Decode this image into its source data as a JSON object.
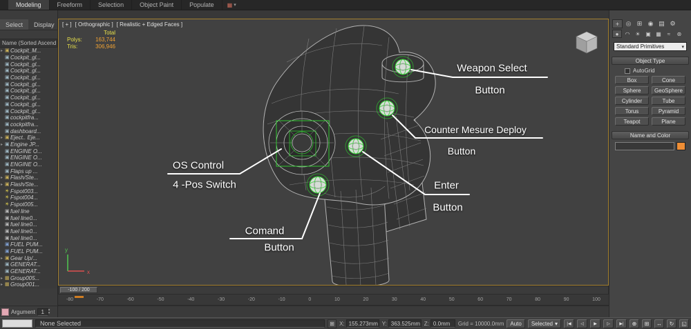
{
  "ribbon": {
    "tabs": [
      "Modeling",
      "Freeform",
      "Selection",
      "Object Paint",
      "Populate"
    ],
    "tool_icon": "▦",
    "dropdown_arrow": "▾"
  },
  "explorer": {
    "tab_select": "Select",
    "tab_display": "Display",
    "header": "Name (Sorted Ascend...",
    "items": [
      {
        "a": "▸",
        "g": "▣",
        "c": "#c9b05a",
        "t": "Cockpit_M..."
      },
      {
        "a": "",
        "g": "▣",
        "c": "#9db6c2",
        "t": "Cockpit_gl..."
      },
      {
        "a": "",
        "g": "▣",
        "c": "#9db6c2",
        "t": "Cockpit_gl..."
      },
      {
        "a": "",
        "g": "▣",
        "c": "#9db6c2",
        "t": "Cockpit_gl..."
      },
      {
        "a": "",
        "g": "▣",
        "c": "#9db6c2",
        "t": "Cockpit_gl..."
      },
      {
        "a": "",
        "g": "▣",
        "c": "#9db6c2",
        "t": "Cockpit_gl..."
      },
      {
        "a": "",
        "g": "▣",
        "c": "#9db6c2",
        "t": "Cockpit_gl..."
      },
      {
        "a": "",
        "g": "▣",
        "c": "#9db6c2",
        "t": "Cockpit_gl..."
      },
      {
        "a": "",
        "g": "▣",
        "c": "#9db6c2",
        "t": "Cockpit_gl..."
      },
      {
        "a": "",
        "g": "▣",
        "c": "#9db6c2",
        "t": "Cockpit_gl..."
      },
      {
        "a": "",
        "g": "▣",
        "c": "#9db6c2",
        "t": "cockpitfra..."
      },
      {
        "a": "",
        "g": "▣",
        "c": "#9db6c2",
        "t": "cockpitfra..."
      },
      {
        "a": "",
        "g": "▣",
        "c": "#9db6c2",
        "t": "dashboard..."
      },
      {
        "a": "▸",
        "g": "▣",
        "c": "#c9b05a",
        "t": "Eject.. Eje..."
      },
      {
        "a": "▸",
        "g": "▣",
        "c": "#9db6c2",
        "t": "Engine JP..."
      },
      {
        "a": "",
        "g": "▣",
        "c": "#9db6c2",
        "t": "ENGINE O..."
      },
      {
        "a": "",
        "g": "▣",
        "c": "#9db6c2",
        "t": "ENGINE O..."
      },
      {
        "a": "",
        "g": "▣",
        "c": "#9db6c2",
        "t": "ENGINE O..."
      },
      {
        "a": "",
        "g": "▣",
        "c": "#9db6c2",
        "t": "Flaps up ..."
      },
      {
        "a": "▸",
        "g": "▣",
        "c": "#c9b05a",
        "t": "Flash/Ste..."
      },
      {
        "a": "▸",
        "g": "▣",
        "c": "#c9b05a",
        "t": "Flash/Ste..."
      },
      {
        "a": "",
        "g": "☀",
        "c": "#e6d44e",
        "t": "Fspot003..."
      },
      {
        "a": "",
        "g": "☀",
        "c": "#e6d44e",
        "t": "Fspot004..."
      },
      {
        "a": "",
        "g": "☀",
        "c": "#e6d44e",
        "t": "Fspot005..."
      },
      {
        "a": "",
        "g": "▣",
        "c": "#b8b8b8",
        "t": "fuel line"
      },
      {
        "a": "",
        "g": "▣",
        "c": "#b8b8b8",
        "t": "fuel line0..."
      },
      {
        "a": "",
        "g": "▣",
        "c": "#b8b8b8",
        "t": "fuel line0..."
      },
      {
        "a": "",
        "g": "▣",
        "c": "#b8b8b8",
        "t": "fuel line0..."
      },
      {
        "a": "",
        "g": "▣",
        "c": "#b8b8b8",
        "t": "fuel line0..."
      },
      {
        "a": "",
        "g": "▣",
        "c": "#7f9fd0",
        "t": "FUEL PUM..."
      },
      {
        "a": "",
        "g": "▣",
        "c": "#7f9fd0",
        "t": "FUEL PUM..."
      },
      {
        "a": "▸",
        "g": "▣",
        "c": "#c9b05a",
        "t": "Gear Up/..."
      },
      {
        "a": "",
        "g": "▣",
        "c": "#9db6c2",
        "t": "GENERAT..."
      },
      {
        "a": "",
        "g": "▣",
        "c": "#9db6c2",
        "t": "GENERAT..."
      },
      {
        "a": "▸",
        "g": "▦",
        "c": "#c9b05a",
        "t": "Group005..."
      },
      {
        "a": "▸",
        "g": "▦",
        "c": "#c9b05a",
        "t": "Group001..."
      }
    ],
    "argument_label": "Argument",
    "argument_value": "1",
    "spinner_up": "▴",
    "spinner_down": "▾"
  },
  "viewport": {
    "menu_plus": "[ + ]",
    "menu_view": "[ Orthographic ]",
    "menu_shading": "[ Realistic + Edged Faces ]",
    "stats": {
      "total_label": "Total",
      "polys_label": "Polys:",
      "polys_value": "163,744",
      "tris_label": "Tris:",
      "tris_value": "306,946"
    },
    "annotations": [
      {
        "line1": "Weapon Select",
        "line2": "Button"
      },
      {
        "line1": "Counter Mesure Deploy",
        "line2": "Button"
      },
      {
        "line1": "Enter",
        "line2": "Button"
      },
      {
        "line1": "Comand",
        "line2": "Button"
      },
      {
        "line1": "OS Control",
        "line2": "4 -Pos Switch"
      }
    ],
    "axis_x": "x",
    "axis_y": "y"
  },
  "command_panel": {
    "tab_icons": [
      "+",
      "◎",
      "⊞",
      "◉",
      "▤",
      "⚙"
    ],
    "category_icons": [
      "●",
      "◠",
      "☀",
      "▣",
      "▦",
      "≈",
      "⊛"
    ],
    "dropdown_value": "Standard Primitives",
    "dropdown_arrow": "▾",
    "object_type_title": "Object Type",
    "autogrid_label": "AutoGrid",
    "object_buttons": [
      "Box",
      "Cone",
      "Sphere",
      "GeoSphere",
      "Cylinder",
      "Tube",
      "Torus",
      "Pyramid",
      "Teapot",
      "Plane"
    ],
    "name_color_title": "Name and Color",
    "name_value": "",
    "swatch_color": "#ef8e35"
  },
  "timeline": {
    "range_label": "-100 / 200",
    "ticks": [
      "-80",
      "-70",
      "-60",
      "-50",
      "-40",
      "-30",
      "-20",
      "-10",
      "0",
      "10",
      "20",
      "30",
      "40",
      "50",
      "60",
      "70",
      "80",
      "90",
      "100"
    ]
  },
  "status": {
    "prompt": "None Selected",
    "lock_icon": "⊞",
    "x_label": "X:",
    "x_value": "155.273mm",
    "y_label": "Y:",
    "y_value": "363.525mm",
    "z_label": "Z:",
    "z_value": "0.0mm",
    "grid_label": "Grid = 10000.0mm",
    "auto_label": "Auto",
    "selected_label": "Selected",
    "dropdown_arrow": "▾",
    "transport": [
      "|◀",
      "◁",
      "▶",
      "▷",
      "▶|"
    ],
    "nav": [
      "⊕",
      "⊞",
      "↔",
      "↻",
      "◱"
    ]
  },
  "colors": {
    "selection_green": "#2fc92f",
    "stats_label": "#e8e04a",
    "stats_value": "#efa133",
    "viewport_border": "#a5812f",
    "listener_pink": "#e3a8b4",
    "frame_marker": "#cf7d22"
  }
}
